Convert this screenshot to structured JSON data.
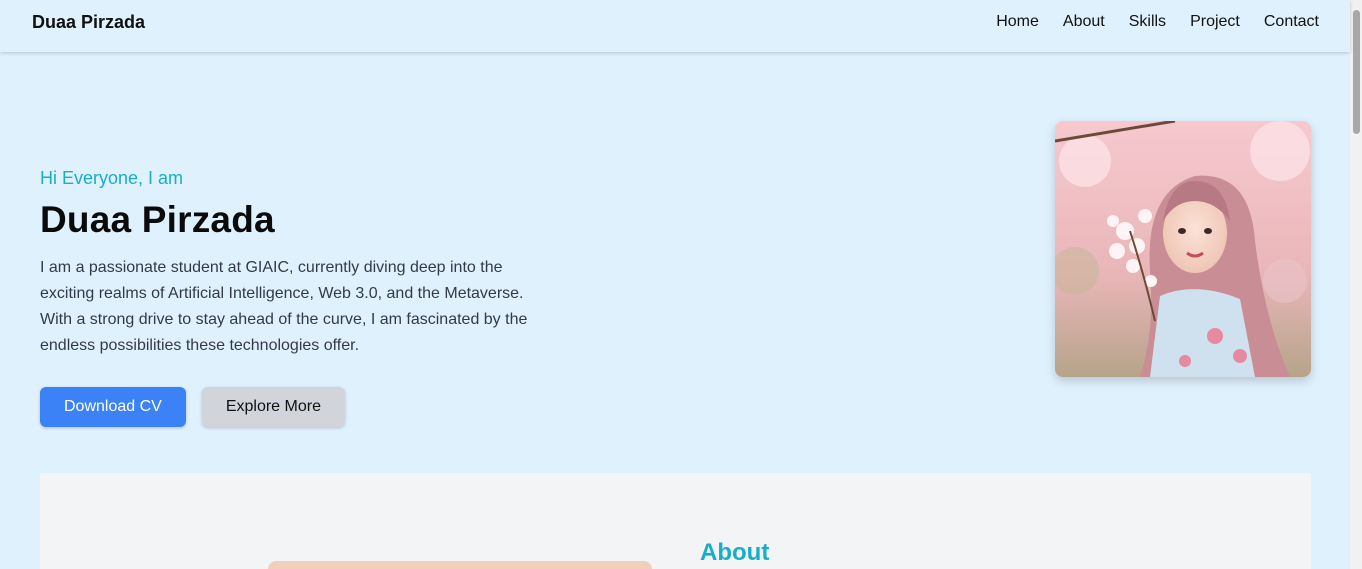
{
  "nav": {
    "brand": "Duaa Pirzada",
    "links": [
      "Home",
      "About",
      "Skills",
      "Project",
      "Contact"
    ]
  },
  "hero": {
    "greeting": "Hi Everyone, I am",
    "name": "Duaa Pirzada",
    "description": "I am a passionate student at GIAIC, currently diving deep into the exciting realms of Artificial Intelligence, Web 3.0, and the Metaverse. With a strong drive to stay ahead of the curve, I am fascinated by the endless possibilities these technologies offer.",
    "download_cv_label": "Download CV",
    "explore_more_label": "Explore More"
  },
  "about": {
    "title": "About"
  },
  "colors": {
    "accent": "#19aec8",
    "primary_button": "#3b82f6",
    "secondary_button": "#d1d5db",
    "page_background": "#dff1fd",
    "section_background": "#f3f4f6"
  }
}
